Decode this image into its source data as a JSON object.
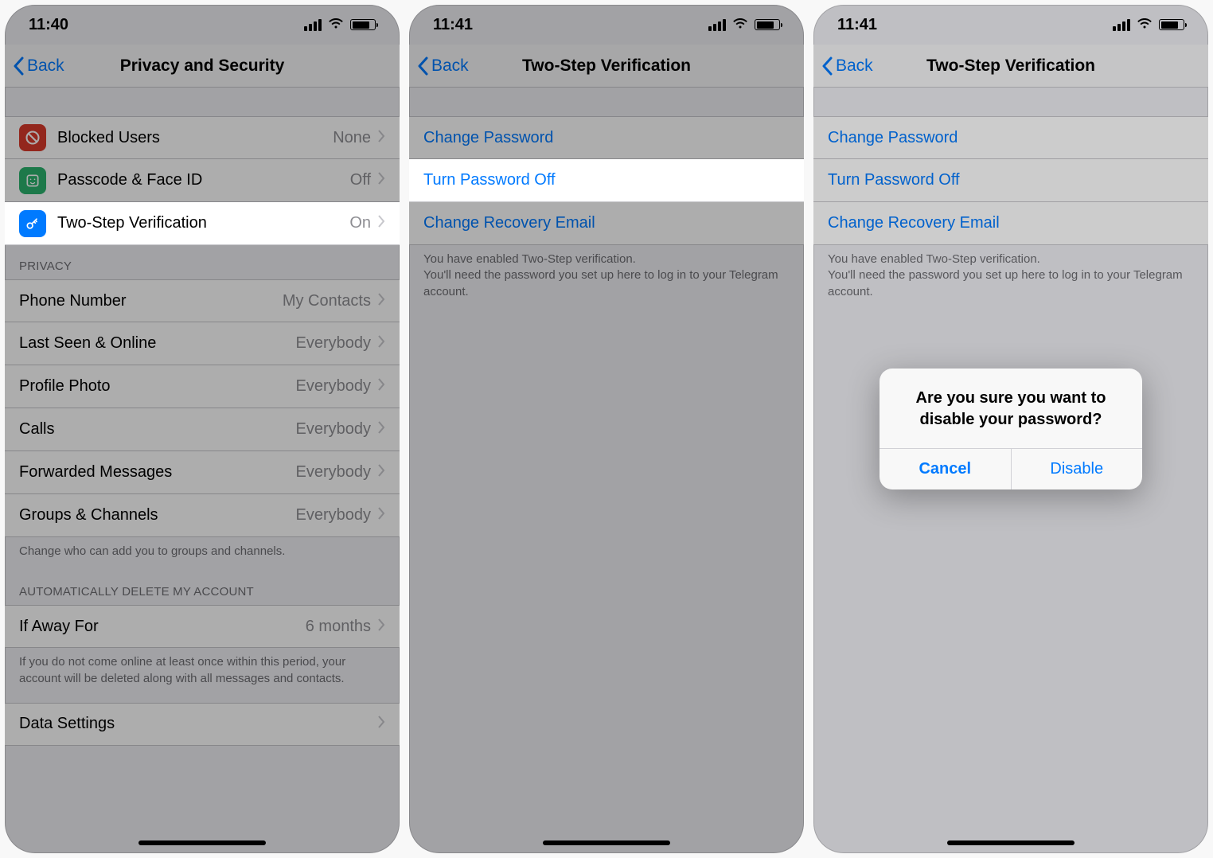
{
  "screen1": {
    "status_time": "11:40",
    "nav_back": "Back",
    "nav_title": "Privacy and Security",
    "rows_security": [
      {
        "label": "Blocked Users",
        "value": "None",
        "icon": "blocked",
        "icon_color": "#d93a2b"
      },
      {
        "label": "Passcode & Face ID",
        "value": "Off",
        "icon": "passcode",
        "icon_color": "#2cb36e"
      },
      {
        "label": "Two-Step Verification",
        "value": "On",
        "icon": "key",
        "icon_color": "#007aff"
      }
    ],
    "privacy_header": "PRIVACY",
    "rows_privacy": [
      {
        "label": "Phone Number",
        "value": "My Contacts"
      },
      {
        "label": "Last Seen & Online",
        "value": "Everybody"
      },
      {
        "label": "Profile Photo",
        "value": "Everybody"
      },
      {
        "label": "Calls",
        "value": "Everybody"
      },
      {
        "label": "Forwarded Messages",
        "value": "Everybody"
      },
      {
        "label": "Groups & Channels",
        "value": "Everybody"
      }
    ],
    "privacy_footer": "Change who can add you to groups and channels.",
    "delete_header": "AUTOMATICALLY DELETE MY ACCOUNT",
    "delete_row": {
      "label": "If Away For",
      "value": "6 months"
    },
    "delete_footer": "If you do not come online at least once within this period, your account will be deleted along with all messages and contacts.",
    "data_settings_label": "Data Settings"
  },
  "screen2": {
    "status_time": "11:41",
    "nav_back": "Back",
    "nav_title": "Two-Step Verification",
    "rows": [
      {
        "label": "Change Password"
      },
      {
        "label": "Turn Password Off"
      },
      {
        "label": "Change Recovery Email"
      }
    ],
    "footer": "You have enabled Two-Step verification.\nYou'll need the password you set up here to log in to your Telegram account."
  },
  "screen3": {
    "status_time": "11:41",
    "nav_back": "Back",
    "nav_title": "Two-Step Verification",
    "rows": [
      {
        "label": "Change Password"
      },
      {
        "label": "Turn Password Off"
      },
      {
        "label": "Change Recovery Email"
      }
    ],
    "footer": "You have enabled Two-Step verification.\nYou'll need the password you set up here to log in to your Telegram account.",
    "alert_message": "Are you sure you want to disable your password?",
    "alert_cancel": "Cancel",
    "alert_confirm": "Disable"
  }
}
